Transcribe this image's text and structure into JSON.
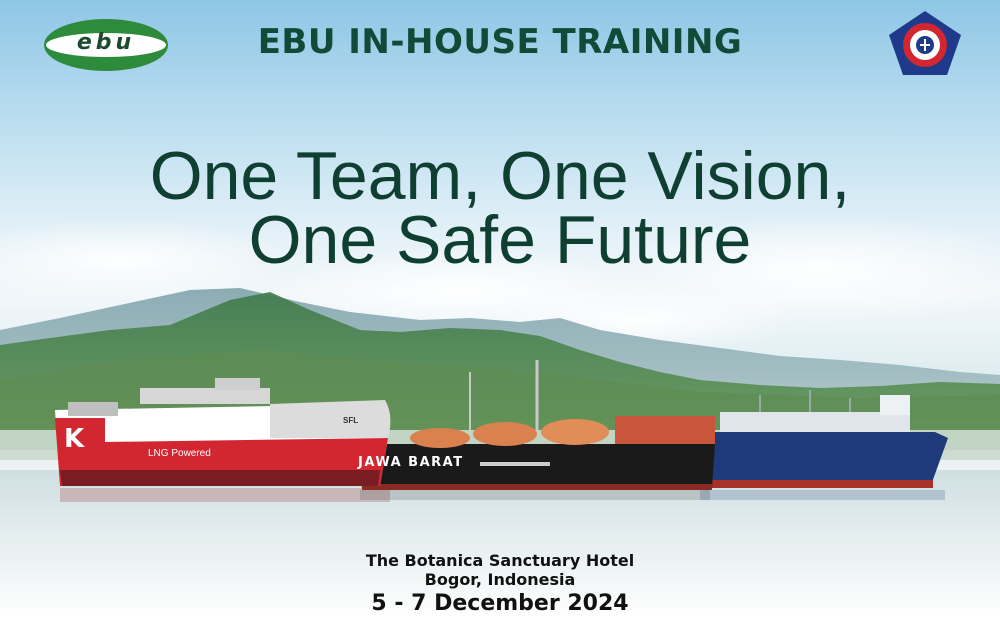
{
  "header": {
    "logo_text": "ebu",
    "title": "EBU IN-HOUSE TRAINING",
    "emblem_icon": "organization-emblem-icon"
  },
  "tagline": {
    "line1": "One Team, One Vision,",
    "line2": "One Safe Future"
  },
  "ships": {
    "car_carrier": {
      "bow_letter": "K",
      "hull_text": "LNG Powered",
      "funnel_text": "SFL"
    },
    "fsru": {
      "hull_name": "JAWA BARAT"
    }
  },
  "event": {
    "venue": "The Botanica Sanctuary Hotel",
    "city": "Bogor, Indonesia",
    "dates": "5 - 7 December 2024"
  },
  "colors": {
    "title_green": "#124a38",
    "logo_green": "#2e8b3c",
    "car_carrier_red": "#d22630",
    "fsru_black": "#1a1a1a",
    "lng_blue": "#1f3a7a"
  }
}
